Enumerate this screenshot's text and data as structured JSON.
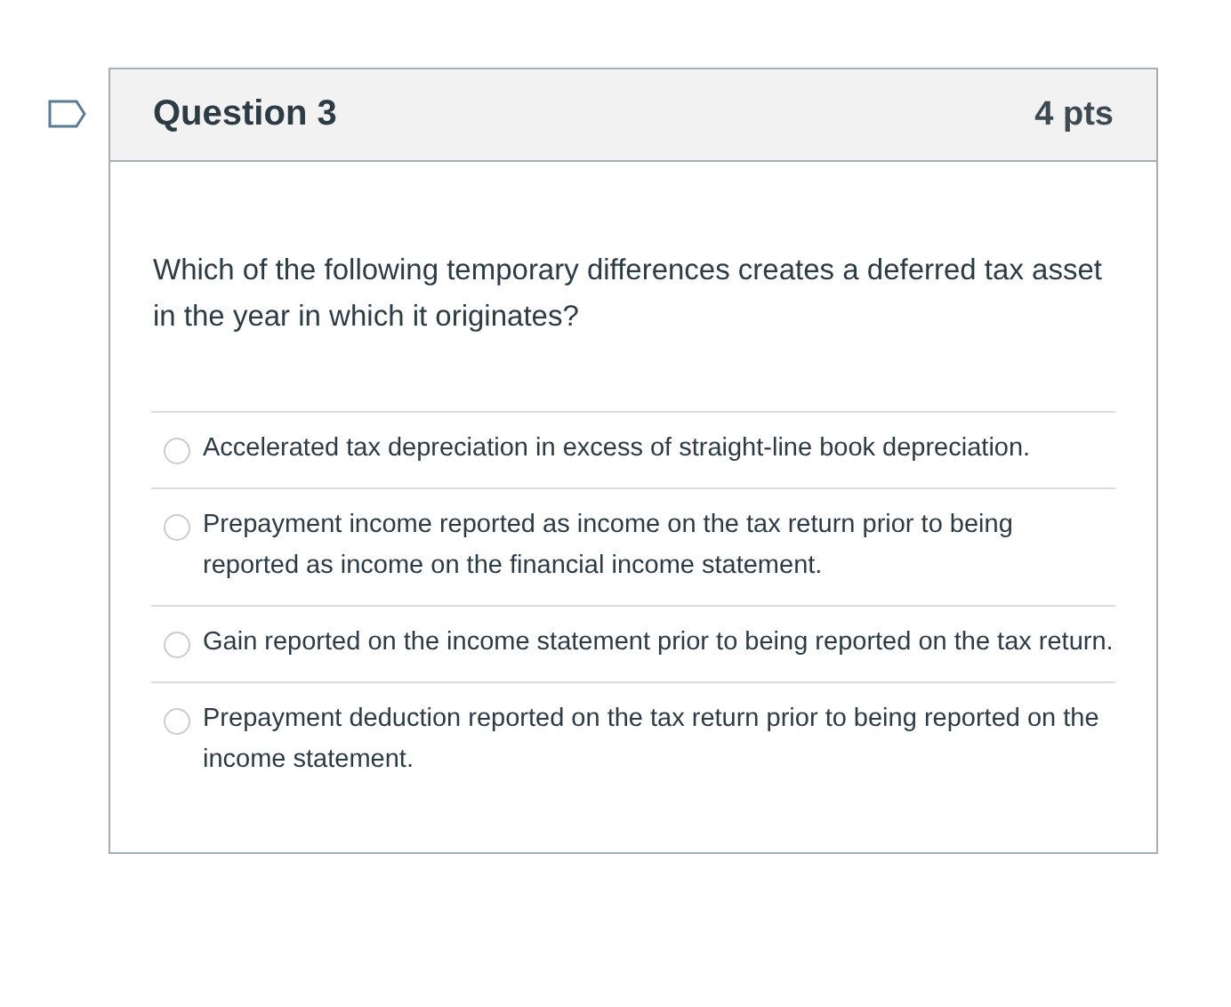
{
  "question": {
    "title": "Question 3",
    "points": "4 pts",
    "text": "Which of the following temporary differences creates a deferred tax asset in the year in which it originates?",
    "answers": [
      {
        "label": "Accelerated tax depreciation in excess of straight-line book depreciation.",
        "selected": false
      },
      {
        "label": "Prepayment income reported as income on the tax return prior to being reported as income on the financial income statement.",
        "selected": false
      },
      {
        "label": "Gain reported on the income statement prior to being reported on the tax return.",
        "selected": false
      },
      {
        "label": "Prepayment deduction reported on the tax return prior to being reported on the income statement.",
        "selected": false
      }
    ]
  }
}
